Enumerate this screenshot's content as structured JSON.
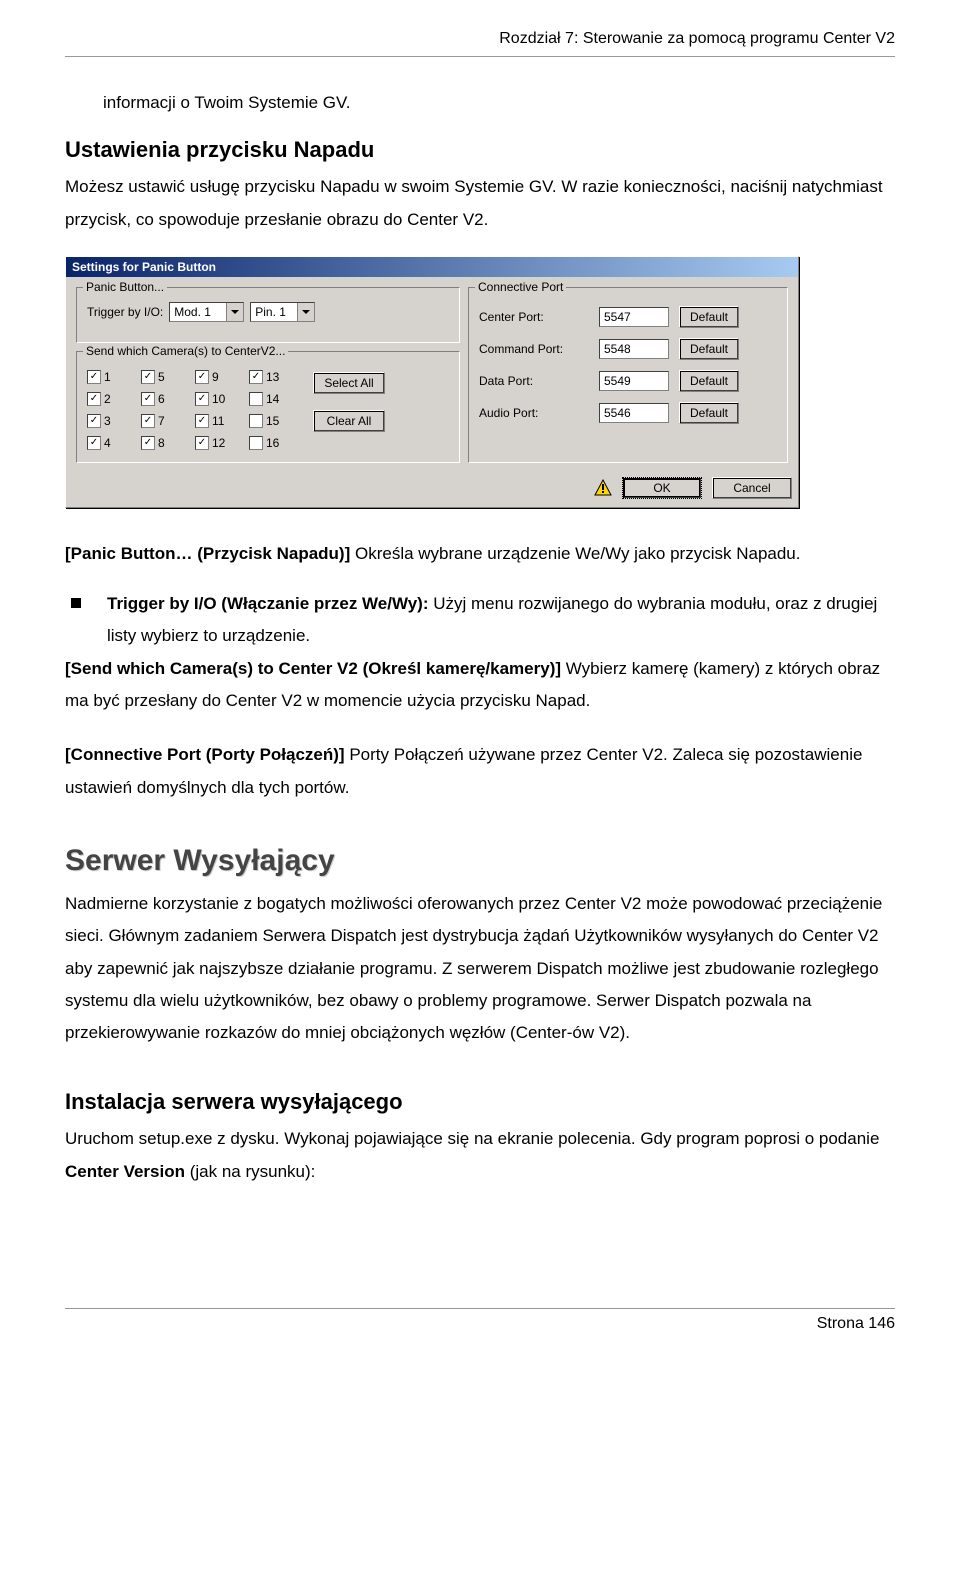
{
  "header": {
    "chapter": "Rozdział 7:   Sterowanie za pomocą programu Center V2"
  },
  "p1": "informacji o Twoim Systemie GV.",
  "h_panic": "Ustawienia przycisku Napadu",
  "p2": "Możesz ustawić usługę przycisku Napadu w swoim Systemie GV. W razie konieczności, naciśnij natychmiast przycisk, co spowoduje przesłanie obrazu do Center V2.",
  "dlg": {
    "title": "Settings for Panic Button",
    "grp_panic": "Panic Button...",
    "trigger_lbl": "Trigger by I/O:",
    "mod": "Mod. 1",
    "pin": "Pin. 1",
    "grp_send": "Send which Camera(s) to CenterV2...",
    "cams": [
      {
        "n": "1",
        "c": true
      },
      {
        "n": "5",
        "c": true
      },
      {
        "n": "9",
        "c": true
      },
      {
        "n": "13",
        "c": true
      },
      {
        "n": "2",
        "c": true
      },
      {
        "n": "6",
        "c": true
      },
      {
        "n": "10",
        "c": true
      },
      {
        "n": "14",
        "c": false
      },
      {
        "n": "3",
        "c": true
      },
      {
        "n": "7",
        "c": true
      },
      {
        "n": "11",
        "c": true
      },
      {
        "n": "15",
        "c": false
      },
      {
        "n": "4",
        "c": true
      },
      {
        "n": "8",
        "c": true
      },
      {
        "n": "12",
        "c": true
      },
      {
        "n": "16",
        "c": false
      }
    ],
    "select_all": "Select All",
    "clear_all": "Clear All",
    "grp_port": "Connective Port",
    "ports": [
      {
        "lbl": "Center Port:",
        "val": "5547"
      },
      {
        "lbl": "Command Port:",
        "val": "5548"
      },
      {
        "lbl": "Data Port:",
        "val": "5549"
      },
      {
        "lbl": "Audio Port:",
        "val": "5546"
      }
    ],
    "default": "Default",
    "ok": "OK",
    "cancel": "Cancel"
  },
  "desc": {
    "panic_label": "[Panic Button… (Przycisk Napadu)]",
    "panic_text": "    Określa wybrane urządzenie We/Wy jako przycisk Napadu.",
    "trigger_label": "Trigger by I/O (Włączanie przez We/Wy):",
    "trigger_text": "    Użyj menu rozwijanego do wybrania modułu, oraz z drugiej listy wybierz to urządzenie.",
    "send_label": "[Send which Camera(s) to Center V2 (Określ kamerę/kamery)]",
    "send_text": "    Wybierz kamerę (kamery) z których obraz ma być przesłany do Center V2 w momencie użycia przycisku Napad.",
    "port_label": "[Connective Port (Porty Połączeń)]",
    "port_text": "    Porty Połączeń używane przez Center V2. Zaleca się pozostawienie ustawień domyślnych dla tych portów."
  },
  "h_serwer": "Serwer Wysyłający",
  "p_serwer": "Nadmierne korzystanie z bogatych możliwości oferowanych przez Center V2 może powodować przeciążenie sieci. Głównym zadaniem Serwera Dispatch jest dystrybucja żądań Użytkowników wysyłanych do Center V2 aby zapewnić jak najszybsze działanie programu. Z serwerem Dispatch możliwe jest zbudowanie rozległego systemu dla wielu użytkowników, bez obawy o problemy programowe. Serwer Dispatch pozwala na przekierowywanie rozkazów do mniej obciążonych węzłów (Center-ów V2).",
  "h_install": "Instalacja serwera wysyłającego",
  "p_install_a": "Uruchom setup.exe z dysku. Wykonaj pojawiające się na ekranie polecenia. Gdy program poprosi o podanie ",
  "p_install_b": "Center Version",
  "p_install_c": " (jak na rysunku):",
  "footer": "Strona 146"
}
